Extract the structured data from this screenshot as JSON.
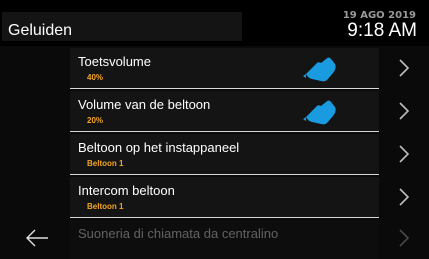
{
  "header": {
    "title": "Geluiden",
    "date": "19 AGO 2019",
    "time": "9:18 AM"
  },
  "items": [
    {
      "label": "Toetsvolume",
      "value": "40%"
    },
    {
      "label": "Volume van de beltoon",
      "value": "20%"
    },
    {
      "label": "Beltoon op het instappaneel",
      "value": "Beltoon 1"
    },
    {
      "label": "Intercom beltoon",
      "value": "Beltoon 1"
    },
    {
      "label": "Suoneria di chiamata da centralino",
      "value": ""
    }
  ],
  "icons": {
    "back": "back-arrow-icon",
    "chevron": "chevron-right-icon",
    "hand": "pointing-hand-icon"
  },
  "colors": {
    "accent": "#f5a623",
    "hand": "#1a9be0"
  }
}
